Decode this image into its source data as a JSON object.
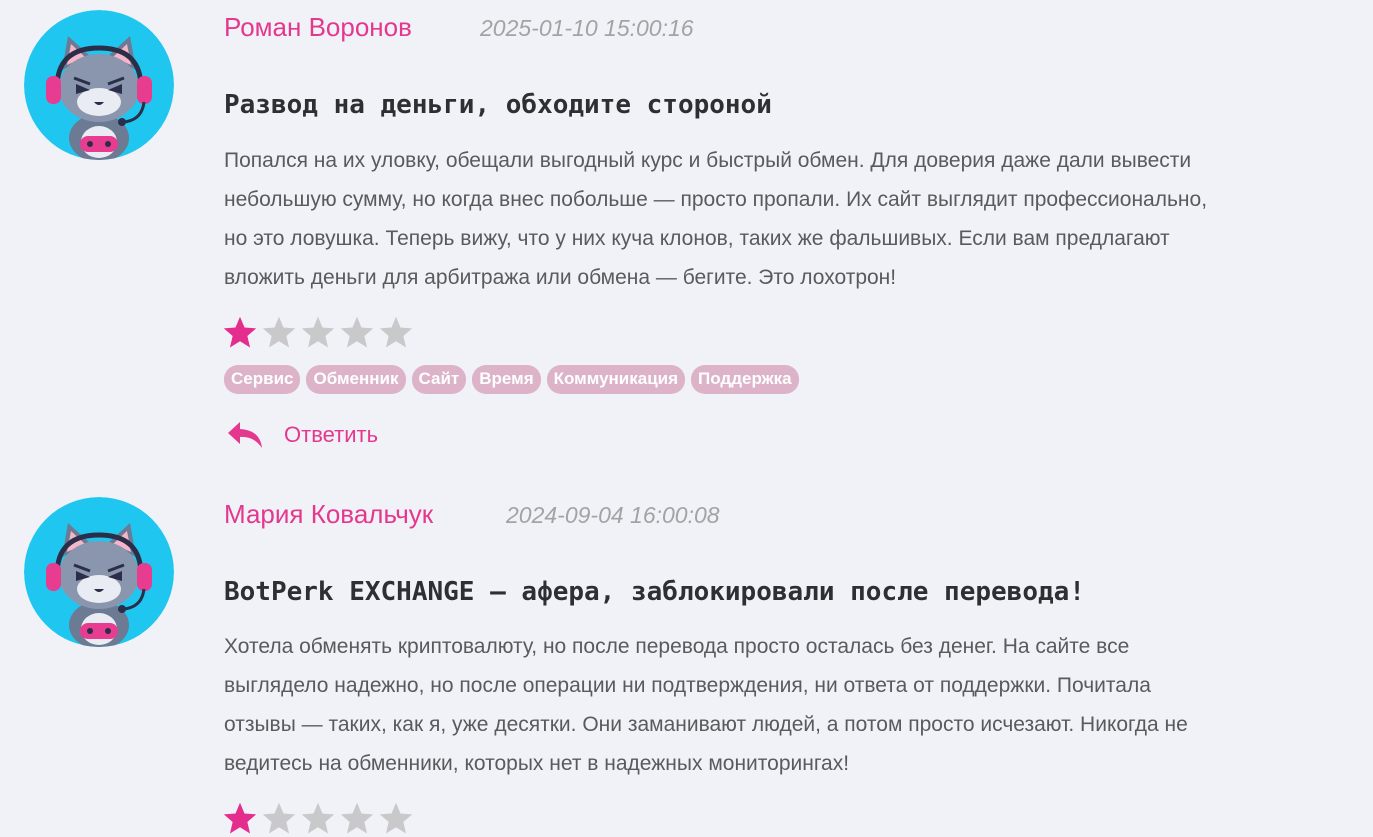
{
  "colors": {
    "accent": "#e4388e",
    "star_filled": "#e42d8c",
    "star_empty": "#c9c9cc",
    "tag_bg": "#dcb3c8",
    "avatar_bg": "#1fc7f0",
    "background": "#f1f2f7"
  },
  "reviews": [
    {
      "author": "Роман Воронов",
      "date": "2025-01-10 15:00:16",
      "avatar_icon": "cat-gamer-avatar-icon",
      "title": "Развод на деньги, обходите стороной",
      "text_lines": [
        "Попался на их уловку, обещали выгодный курс и быстрый обмен. Для доверия даже дали вывести",
        "небольшую сумму, но когда внес побольше — просто пропали. Их сайт выглядит профессионально,",
        "но это ловушка. Теперь вижу, что у них куча клонов, таких же фальшивых. Если вам предлагают",
        "вложить деньги для арбитража или обмена — бегите. Это лохотрон!"
      ],
      "rating": 1,
      "rating_max": 5,
      "tags": [
        "Сервис",
        "Обменник",
        "Сайт",
        "Время",
        "Коммуникация",
        "Поддержка"
      ],
      "reply_label": "Ответить",
      "reply_icon": "reply-arrow-icon"
    },
    {
      "author": "Мария Ковальчук",
      "date": "2024-09-04 16:00:08",
      "avatar_icon": "cat-gamer-avatar-icon",
      "title": "BotPerk EXCHANGE — афера, заблокировали после перевода!",
      "text_lines": [
        "Хотела обменять криптовалюту, но после перевода просто осталась без денег. На сайте все",
        "выглядело надежно, но после операции ни подтверждения, ни ответа от поддержки. Почитала",
        "отзывы — таких, как я, уже десятки. Они заманивают людей, а потом просто исчезают. Никогда не",
        "ведитесь на обменники, которых нет в надежных мониторингах!"
      ],
      "rating": 1,
      "rating_max": 5
    }
  ]
}
